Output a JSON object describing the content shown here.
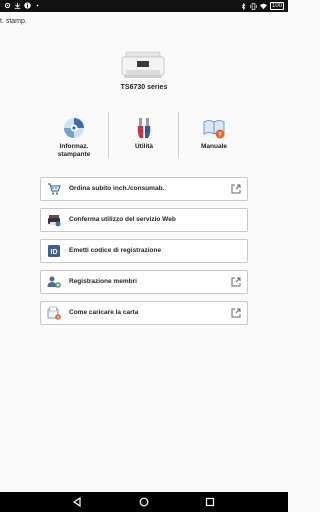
{
  "status_bar": {
    "battery_level": "100",
    "left_icons": [
      "gear-icon",
      "download-icon",
      "info-icon",
      "dots-icon"
    ],
    "right_icons": [
      "bluetooth-icon",
      "vibrate-icon",
      "wifi-icon"
    ]
  },
  "header": {
    "partial_title": "t. stamp."
  },
  "printer": {
    "model": "TS6730 series"
  },
  "nav": [
    {
      "label_line1": "Informaz.",
      "label_line2": "stampante",
      "icon": "printer-info-icon"
    },
    {
      "label_line1": "Utilità",
      "label_line2": "",
      "icon": "tools-icon"
    },
    {
      "label_line1": "Manuale",
      "label_line2": "",
      "icon": "manual-icon"
    }
  ],
  "menu": [
    {
      "label": "Ordina subito inch./consumab.",
      "icon": "cart-icon",
      "external": true
    },
    {
      "label": "Conferma utilizzo del servizio Web",
      "icon": "web-service-icon",
      "external": false
    },
    {
      "label": "Emetti codice di registrazione",
      "icon": "id-icon",
      "external": false
    },
    {
      "label": "Registrazione membri",
      "icon": "member-add-icon",
      "external": true
    },
    {
      "label": "Come caricare la carta",
      "icon": "paper-load-icon",
      "external": true
    }
  ],
  "colors": {
    "accent": "#3a6fb0",
    "warning": "#e8622a",
    "tools_red": "#d0303a"
  }
}
